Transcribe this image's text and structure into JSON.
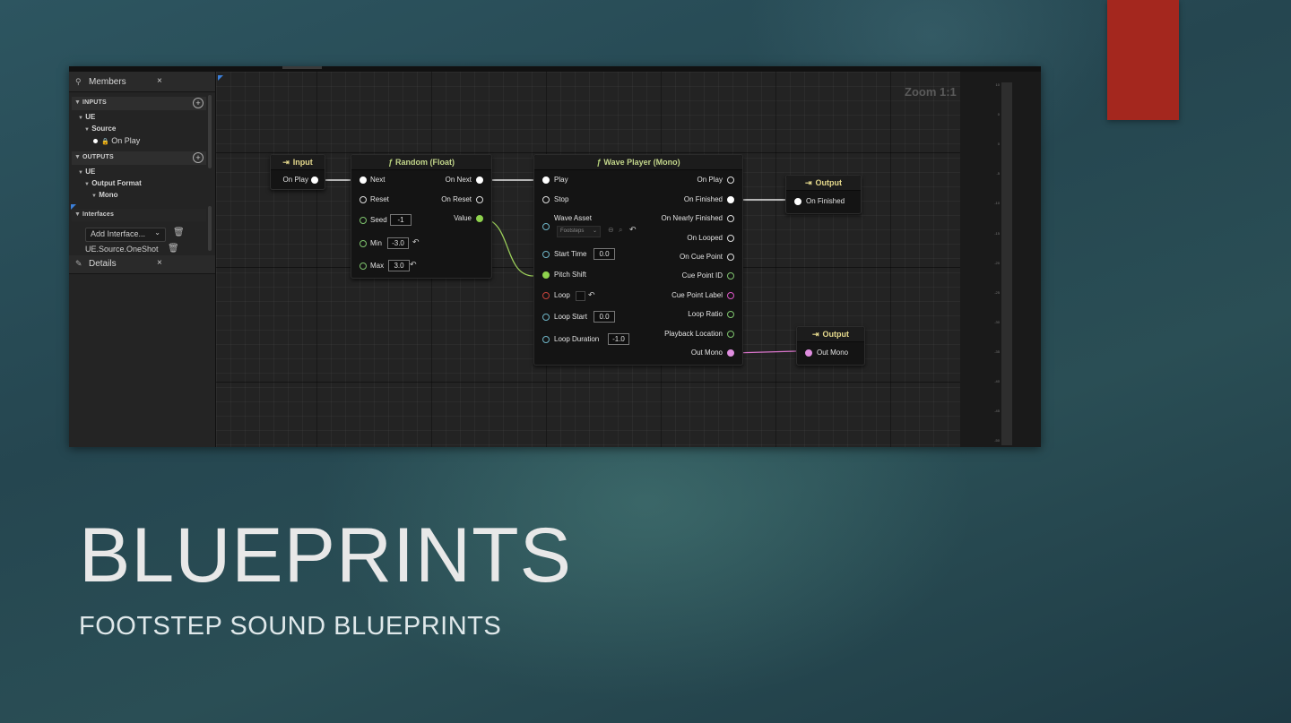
{
  "slide": {
    "title": "BLUEPRINTS",
    "subtitle": "FOOTSTEP SOUND BLUEPRINTS",
    "accent_color": "#a4271e"
  },
  "members_panel": {
    "tab_label": "Members",
    "close": "×",
    "inputs_header": "INPUTS",
    "inputs_ue": "UE",
    "inputs_source": "Source",
    "inputs_on_play": "On Play",
    "outputs_header": "OUTPUTS",
    "outputs_ue": "UE",
    "outputs_format": "Output Format",
    "outputs_mono": "Mono",
    "interfaces_header": "Interfaces",
    "add_interface": "Add Interface...",
    "interface_item": "UE.Source.OneShot"
  },
  "details_panel": {
    "tab_label": "Details",
    "close": "×"
  },
  "graph": {
    "zoom_label": "Zoom 1:1"
  },
  "meter_ticks": [
    "10",
    "0",
    "0",
    "-5",
    "-10",
    "-15",
    "-20",
    "-25",
    "-30",
    "-35",
    "-40",
    "-45",
    "-50"
  ],
  "nodes": {
    "input": {
      "title": "Input",
      "out": "On Play"
    },
    "random": {
      "title": "Random (Float)",
      "next": "Next",
      "reset": "Reset",
      "seed": "Seed",
      "seed_val": "-1",
      "min": "Min",
      "min_val": "-3.0",
      "max": "Max",
      "max_val": "3.0",
      "on_next": "On Next",
      "on_reset": "On Reset",
      "value": "Value"
    },
    "wave": {
      "title": "Wave Player (Mono)",
      "play": "Play",
      "stop": "Stop",
      "wave_asset": "Wave Asset",
      "asset_val": "Footsteps",
      "start_time": "Start Time",
      "start_val": "0.0",
      "pitch_shift": "Pitch Shift",
      "loop": "Loop",
      "loop_start": "Loop Start",
      "loop_start_val": "0.0",
      "loop_duration": "Loop Duration",
      "loop_duration_val": "-1.0",
      "on_play": "On Play",
      "on_finished": "On Finished",
      "on_nearly_finished": "On Nearly Finished",
      "on_looped": "On Looped",
      "on_cue_point": "On Cue Point",
      "cue_point_id": "Cue Point ID",
      "cue_point_label": "Cue Point Label",
      "loop_ratio": "Loop Ratio",
      "playback_location": "Playback Location",
      "out_mono": "Out Mono"
    },
    "output1": {
      "title": "Output",
      "in": "On Finished"
    },
    "output2": {
      "title": "Output",
      "in": "Out Mono"
    }
  }
}
